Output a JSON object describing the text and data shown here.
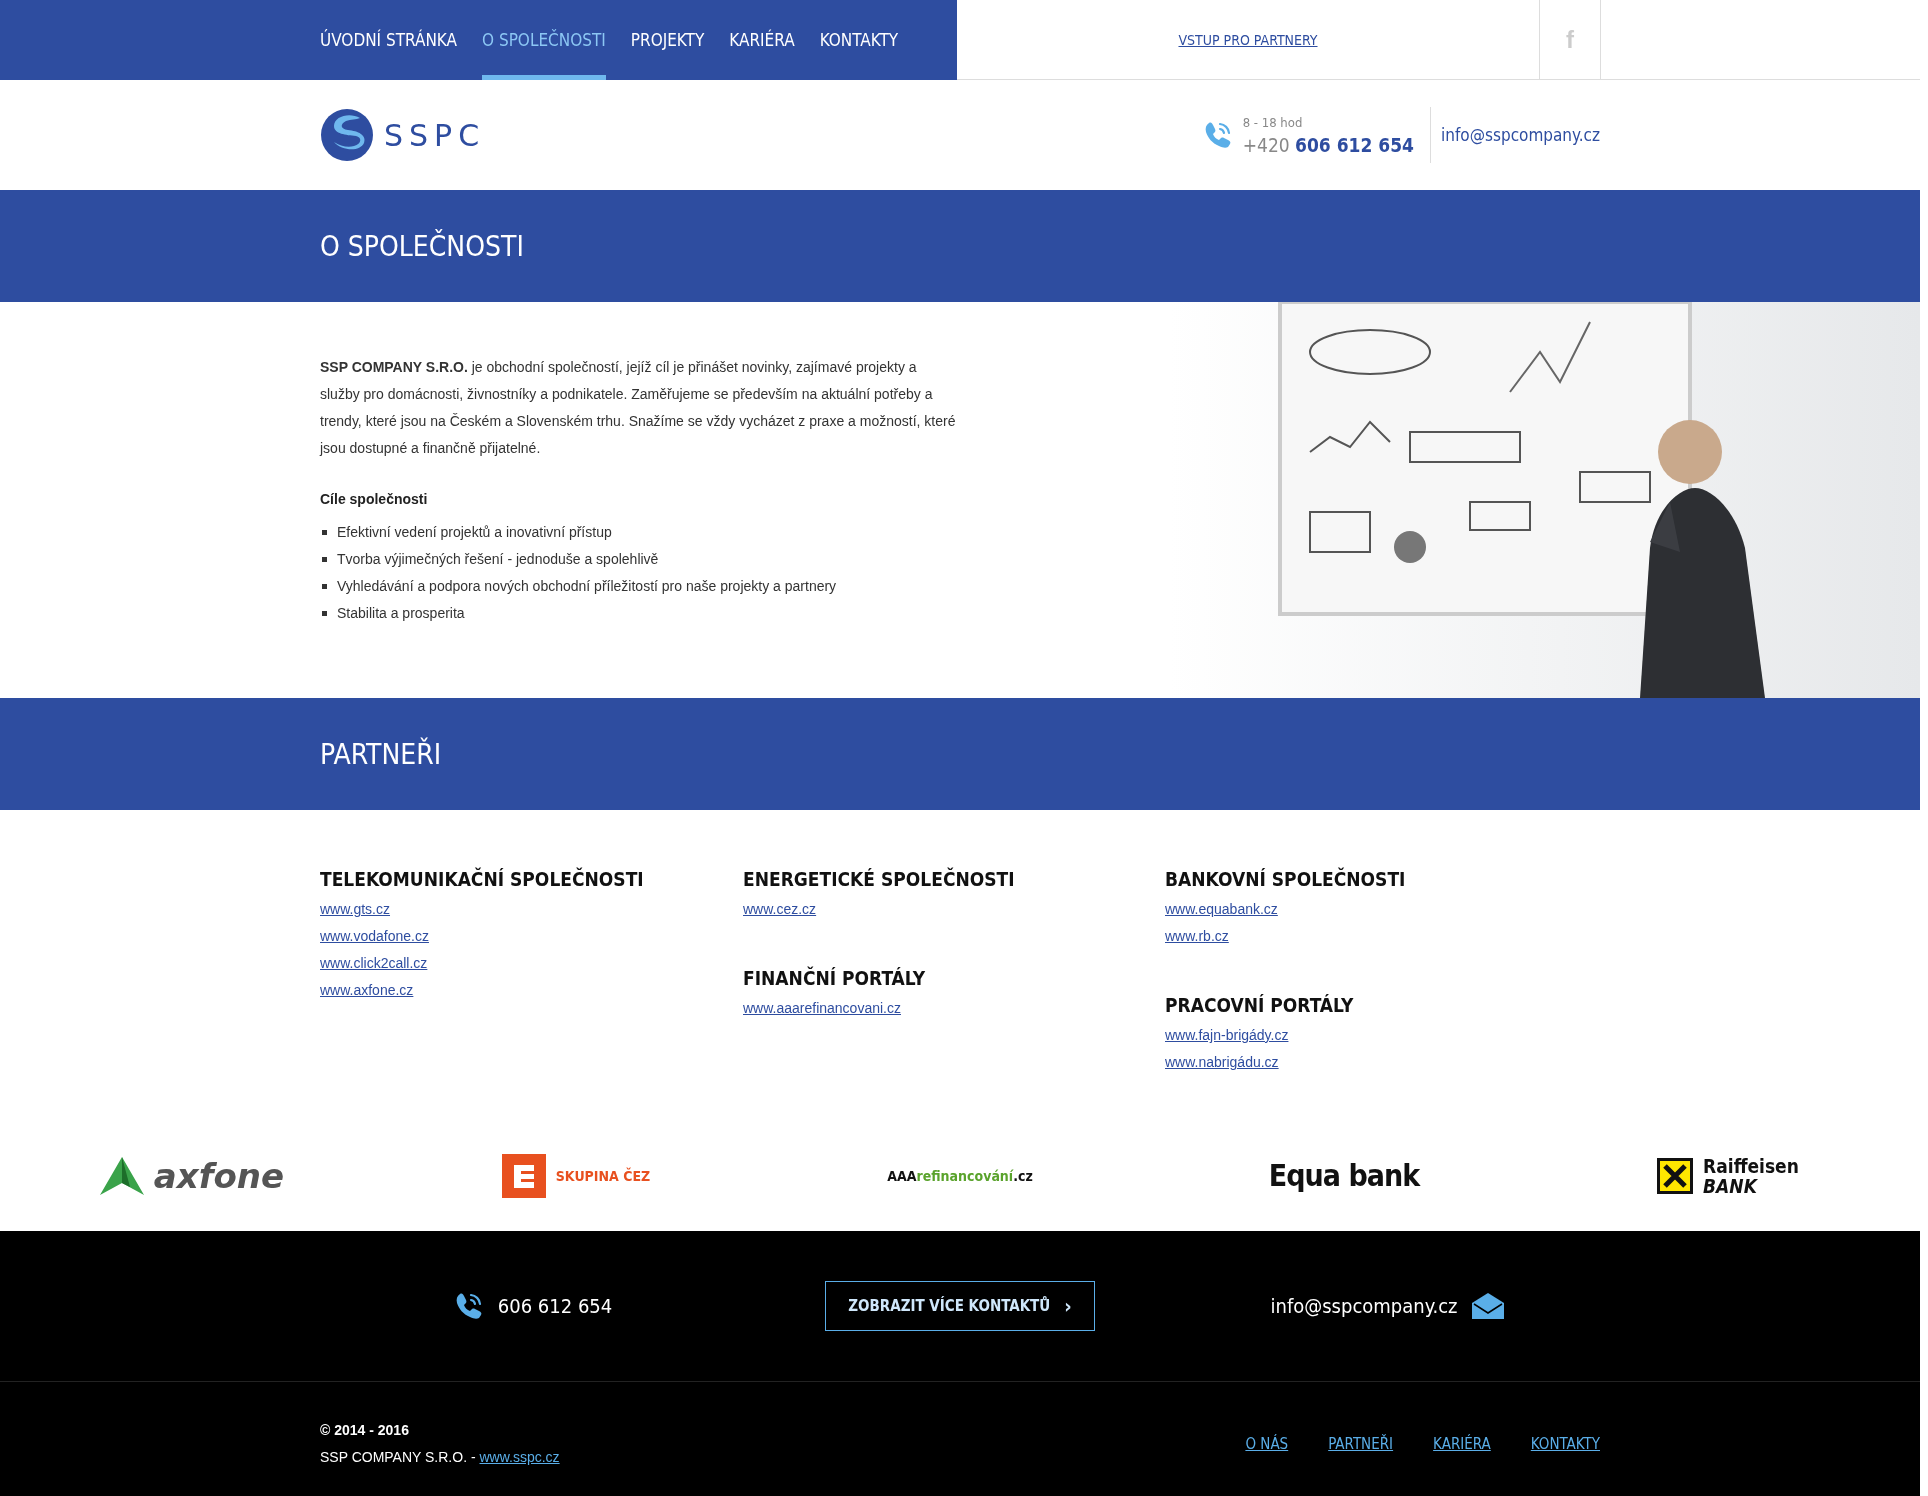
{
  "top_nav": {
    "items": [
      {
        "label": "ÚVODNÍ STRÁNKA",
        "selected": false
      },
      {
        "label": "O SPOLEČNOSTI",
        "selected": true
      },
      {
        "label": "PROJEKTY",
        "selected": false
      },
      {
        "label": "KARIÉRA",
        "selected": false
      },
      {
        "label": "KONTAKTY",
        "selected": false
      }
    ],
    "partner_link": "VSTUP PRO PARTNERY",
    "social_icon": "f"
  },
  "header": {
    "logo_text": "SSPC",
    "hours": "8 - 18 hod",
    "phone_prefix": "+420",
    "phone_number": "606 612 654",
    "email": "info@sspcompany.cz"
  },
  "page_title": "O SPOLEČNOSTI",
  "about": {
    "intro": "**SSP COMPANY S.R.O.** je obchodní společností, jejíž cíl je přinášet novinky, zajímavé projekty a služby pro domácnosti, živnostníky a podnikatele. Zaměřujeme se především na aktuální potřeby a trendy, které jsou na Českém a Slovenském trhu. Snažíme se vždy vycházet z praxe a možností, které jsou dostupné a finančně přijatelné.",
    "goals_title": "Cíle společnosti",
    "goals": [
      "Efektivní vedení projektů a inovativní přístup",
      "Tvorba výjimečných řešení - jednoduše a spolehlivě",
      "Vyhledávání a podpora nových obchodní příležitostí pro naše projekty a partnery",
      "Stabilita a prosperita"
    ],
    "image": {
      "kind": "picture"
    }
  },
  "partners_title": "PARTNEŘI",
  "partner_columns": [
    [
      {
        "title": "TELEKOMUNIKAČNÍ SPOLEČNOSTI",
        "links": [
          "www.gts.cz",
          "www.vodafone.cz",
          "www.click2call.cz",
          "www.axfone.cz"
        ]
      }
    ],
    [
      {
        "title": "ENERGETICKÉ SPOLEČNOSTI",
        "links": [
          "www.cez.cz"
        ]
      },
      {
        "title": "FINANČNÍ PORTÁLY",
        "links": [
          "www.aaarefinancovani.cz"
        ]
      }
    ],
    [
      {
        "title": "BANKOVNÍ SPOLEČNOSTI",
        "links": [
          "www.equabank.cz",
          "www.rb.cz"
        ]
      },
      {
        "title": "PRACOVNÍ PORTÁLY",
        "links": [
          "www.fajn-brigády.cz",
          "www.nabrigádu.cz"
        ]
      }
    ]
  ],
  "logos": [
    {
      "kind": "axfone",
      "lines": [
        "axfone"
      ]
    },
    {
      "kind": "cez",
      "lines": [
        "SKUPINA ČEZ"
      ]
    },
    {
      "kind": "aaa",
      "lines": [
        "**AAA**refinancování**.cz**"
      ]
    },
    {
      "kind": "equa",
      "lines": [
        "Equa bank"
      ]
    },
    {
      "kind": "raiffeisen",
      "lines": [
        "Raiffeisen",
        "BANK"
      ]
    }
  ],
  "contact_bar": {
    "phone": "606 612 654",
    "button": "ZOBRAZIT VÍCE KONTAKTŮ",
    "button_arrow": "›",
    "email": "info@sspcompany.cz"
  },
  "footer": {
    "copyright": "© 2014 - 2016",
    "company": "SSP COMPANY S.R.O. -",
    "company_link": "www.sspc.cz",
    "links": [
      "O NÁS",
      "PARTNEŘI",
      "KARIÉRA",
      "KONTAKTY"
    ]
  }
}
